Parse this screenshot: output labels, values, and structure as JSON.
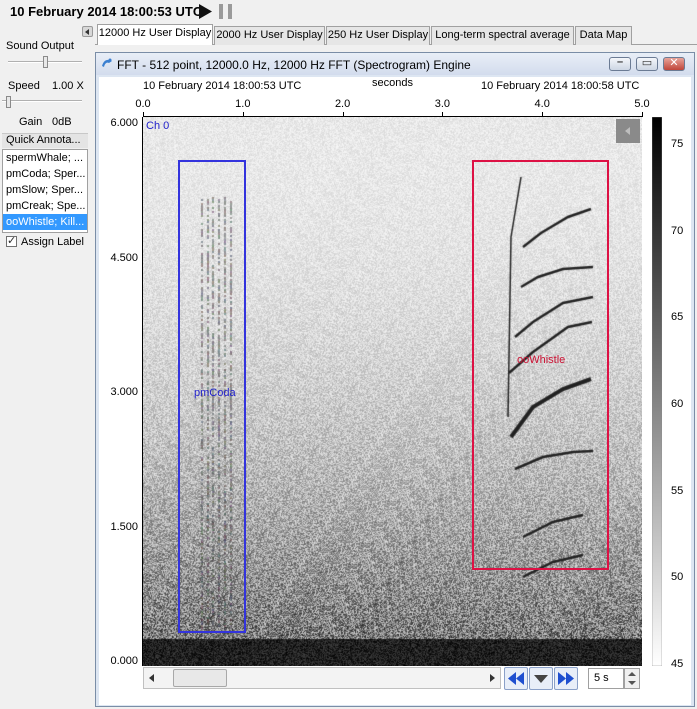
{
  "status_bar": {
    "datetime": "10 February 2014 18:00:53 UTC"
  },
  "left_panel": {
    "sound_output_label": "Sound Output",
    "speed_label": "Speed",
    "speed_value": "1.00 X",
    "gain_label": "Gain",
    "gain_value": "0dB",
    "quick_annotation_header": "Quick Annota...",
    "annotation_items": [
      "spermWhale; ...",
      "pmCoda; Sper...",
      "pmSlow; Sper...",
      "pmCreak; Spe...",
      "ooWhistle; Kill..."
    ],
    "selected_annotation_index": 4,
    "assign_label": "Assign Label",
    "assign_label_checked": true
  },
  "tabs": [
    "12000 Hz User Display",
    "2000 Hz User Display",
    "250 Hz User Display",
    "Long-term spectral average",
    "Data Map"
  ],
  "active_tab_index": 0,
  "fft_window": {
    "title": "FFT - 512 point, 12000.0 Hz, 12000 Hz FFT (Spectrogram) Engine",
    "time_start": "10 February 2014 18:00:53 UTC",
    "time_end": "10 February 2014 18:00:58 UTC",
    "x_axis_title": "seconds",
    "x_ticks": [
      "0.0",
      "1.0",
      "2.0",
      "3.0",
      "4.0",
      "5.0"
    ],
    "y_ticks": [
      "6.000",
      "4.500",
      "3.000",
      "1.500",
      "0.000"
    ],
    "channel_label": "Ch 0",
    "annotations": [
      {
        "label": "pmCoda",
        "color": "#3333dd"
      },
      {
        "label": "ooWhistle",
        "color": "#dd1144"
      }
    ],
    "colorbar_ticks": [
      "75",
      "70",
      "65",
      "60",
      "55",
      "50",
      "45"
    ],
    "display_span": "5 s"
  },
  "icons": {
    "play": "play-icon",
    "pause": "pause-icon",
    "rewind": "fast-backward-icon",
    "dropdown": "triangle-down-icon",
    "forward": "fast-forward-icon"
  }
}
